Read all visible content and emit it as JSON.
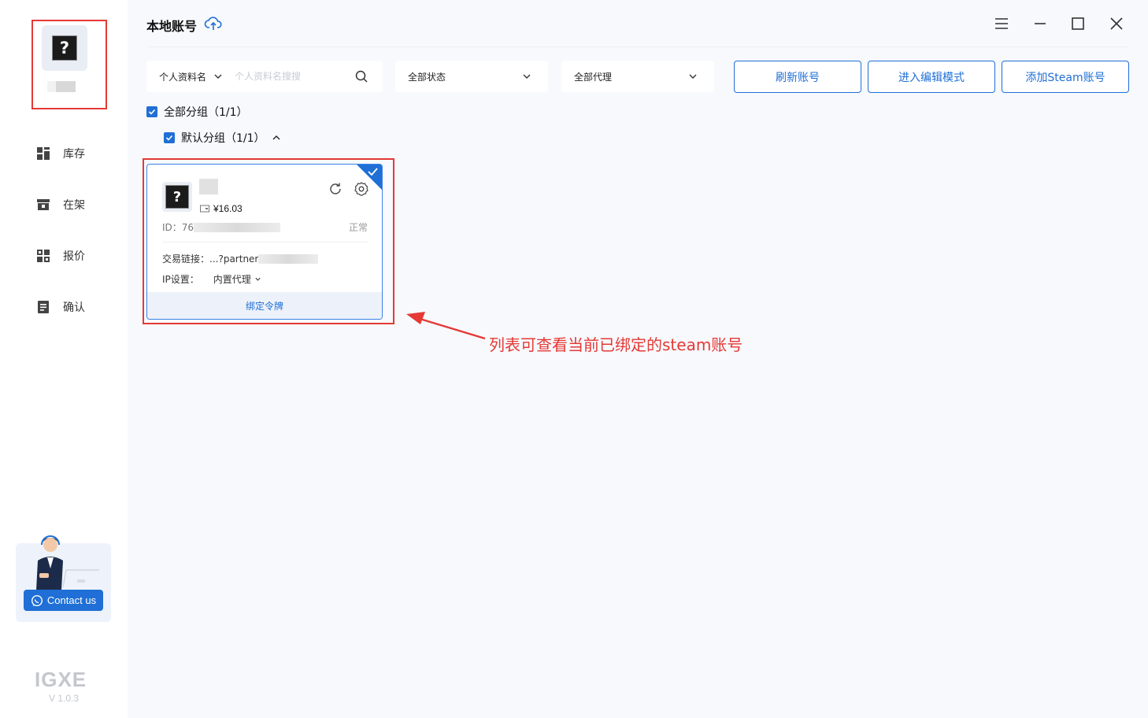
{
  "sidebar": {
    "nav": [
      {
        "label": "库存",
        "icon": "dashboard-icon"
      },
      {
        "label": "在架",
        "icon": "shelf-icon"
      },
      {
        "label": "报价",
        "icon": "grid-icon"
      },
      {
        "label": "确认",
        "icon": "checklist-icon"
      }
    ],
    "contact_label": "Contact us",
    "logo": "IGXE",
    "version": "V 1.0.3"
  },
  "header": {
    "title": "本地账号"
  },
  "filters": {
    "profile_label": "个人资料名",
    "search_placeholder": "个人资料名搜搜",
    "status_label": "全部状态",
    "proxy_label": "全部代理"
  },
  "actions": {
    "refresh": "刷新账号",
    "edit_mode": "进入编辑模式",
    "add_steam": "添加Steam账号"
  },
  "groups": {
    "all": "全部分组（1/1）",
    "default": "默认分组（1/1）"
  },
  "account_card": {
    "balance": "¥16.03",
    "id_prefix": "ID：76",
    "status": "正常",
    "trade_label": "交易链接：",
    "trade_value": "...?partner",
    "ip_label": "IP设置：",
    "ip_value": "内置代理",
    "bind_label": "绑定令牌"
  },
  "annotation": {
    "text": "列表可查看当前已绑定的steam账号"
  },
  "colors": {
    "accent": "#1f6fd6",
    "annotation": "#e53935"
  }
}
